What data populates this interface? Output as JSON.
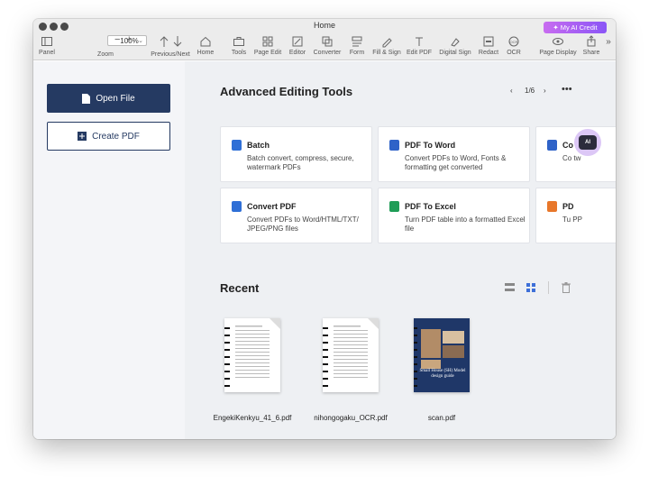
{
  "window": {
    "title": "Home"
  },
  "ai_credit": {
    "label": "My AI Credit"
  },
  "toolbar": {
    "zoom_value": "100%",
    "items": [
      {
        "label": "Panel"
      },
      {
        "label": "Zoom"
      },
      {
        "label": "Previous/Next"
      },
      {
        "label": "Home"
      },
      {
        "label": "Tools"
      },
      {
        "label": "Page Edit"
      },
      {
        "label": "Editor"
      },
      {
        "label": "Converter"
      },
      {
        "label": "Form"
      },
      {
        "label": "Fill & Sign"
      },
      {
        "label": "Edit PDF"
      },
      {
        "label": "Digital Sign"
      },
      {
        "label": "Redact"
      },
      {
        "label": "OCR"
      },
      {
        "label": "Page Display"
      },
      {
        "label": "Share"
      }
    ]
  },
  "sidebar": {
    "open_file": "Open File",
    "create_pdf": "Create PDF"
  },
  "tools": {
    "title": "Advanced Editing Tools",
    "page_indicator": "1/6",
    "cards": [
      {
        "title": "Batch",
        "desc": "Batch convert, compress, secure, watermark PDFs",
        "icon": "batch-icon",
        "color": "#2f6fd6"
      },
      {
        "title": "PDF To Word",
        "desc": "Convert PDFs to Word, Fonts & formatting get converted",
        "icon": "word-icon",
        "color": "#2f63c8"
      },
      {
        "title": "Co",
        "desc": "Co tw",
        "icon": "word-icon",
        "color": "#2f63c8"
      },
      {
        "title": "Convert PDF",
        "desc": "Convert PDFs to Word/HTML/TXT/ JPEG/PNG files",
        "icon": "convert-icon",
        "color": "#2f6fd6"
      },
      {
        "title": "PDF To Excel",
        "desc": "Turn PDF table into a formatted Excel file",
        "icon": "excel-icon",
        "color": "#1f9d57"
      },
      {
        "title": "PD",
        "desc": "Tu PP",
        "icon": "ppt-icon",
        "color": "#e8772a"
      }
    ]
  },
  "recent": {
    "title": "Recent",
    "files": [
      {
        "name": "EngekiKenkyu_41_6.pdf"
      },
      {
        "name": "nihongogaku_OCR.pdf"
      },
      {
        "name": "scan.pdf",
        "cover_title": "Small House (SH) Model design guide"
      }
    ]
  },
  "ai_fab": {
    "label": "AI"
  }
}
